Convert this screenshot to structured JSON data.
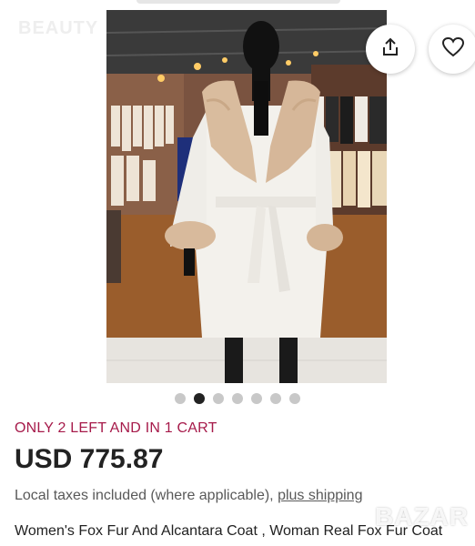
{
  "watermarks": {
    "top_left": "BEAUTY",
    "bottom_right": "BAZAR"
  },
  "gallery": {
    "image_subject": "Women's fox fur and alcantara coat on mannequin in fur boutique",
    "dot_count": 7,
    "active_index": 1
  },
  "actions": {
    "share_icon": "share-icon",
    "favorite_icon": "heart-icon"
  },
  "listing": {
    "stock_message": "ONLY 2 LEFT AND IN 1 CART",
    "price": "USD 775.87",
    "taxes_text": "Local taxes included (where applicable), ",
    "shipping_link": "plus shipping",
    "title": "Women's Fox Fur And Alcantara Coat , Woman Real Fox Fur Coat"
  },
  "colors": {
    "stock_accent": "#a61a4a",
    "active_dot": "#222222",
    "inactive_dot": "#c8c8c8"
  }
}
